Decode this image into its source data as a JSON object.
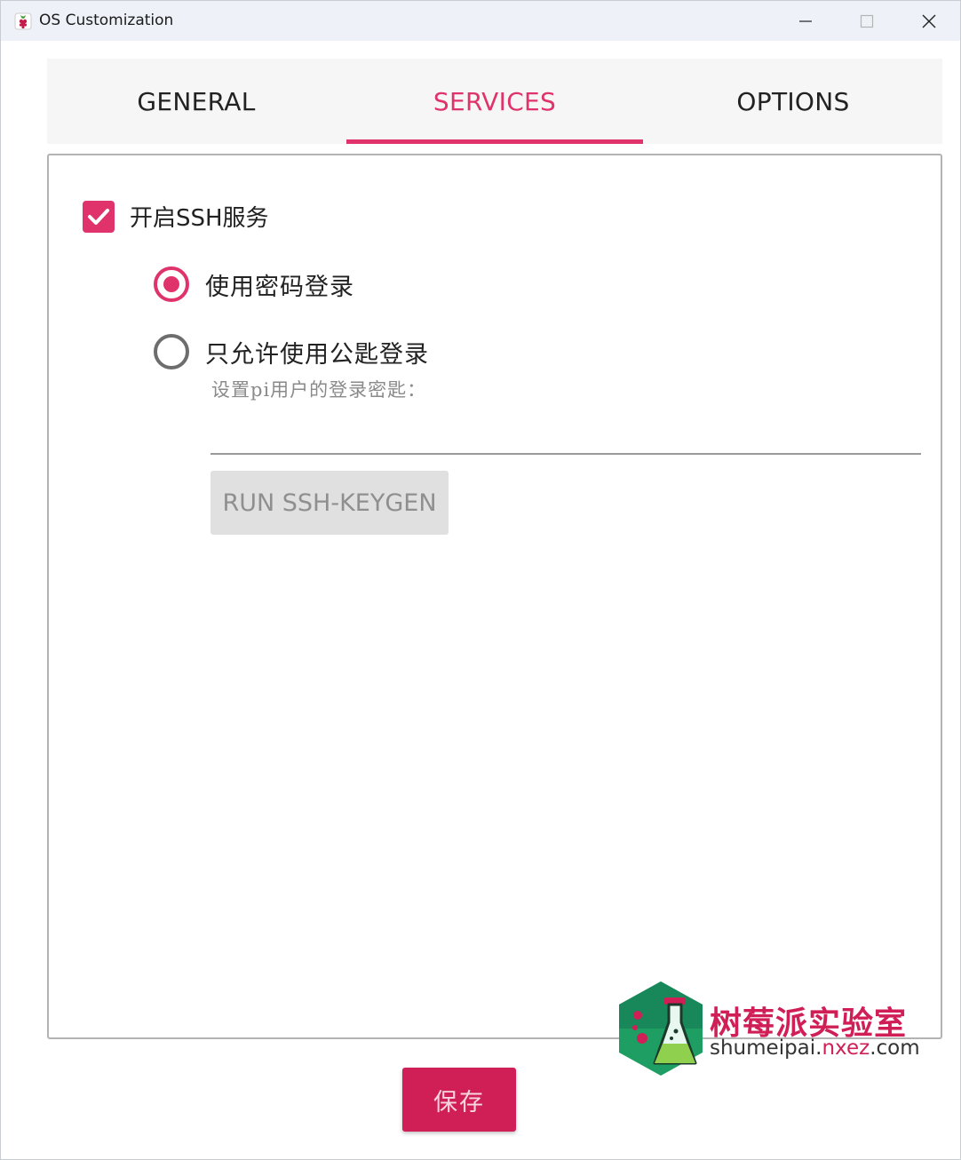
{
  "window": {
    "title": "OS Customization",
    "controls": [
      "minimize-icon",
      "maximize-icon",
      "close-icon"
    ]
  },
  "tabs": [
    {
      "label": "GENERAL",
      "active": false
    },
    {
      "label": "SERVICES",
      "active": true
    },
    {
      "label": "OPTIONS",
      "active": false
    }
  ],
  "services": {
    "ssh_checkbox": {
      "label": "开启SSH服务",
      "checked": true
    },
    "auth_options": [
      {
        "label": "使用密码登录",
        "selected": true
      },
      {
        "label": "只允许使用公匙登录",
        "selected": false
      }
    ],
    "key_hint": "设置pi用户的登录密匙：",
    "key_value": "",
    "keygen_button": "RUN SSH-KEYGEN"
  },
  "footer": {
    "save_button": "保存"
  },
  "watermark": {
    "name": "树莓派实验室",
    "url_prefix": "shumeipai.",
    "url_accent": "nxez",
    "url_suffix": ".com"
  },
  "colors": {
    "accent": "#e0336b",
    "save_button": "#d01f57",
    "disabled_button": "#e0e0e0"
  }
}
